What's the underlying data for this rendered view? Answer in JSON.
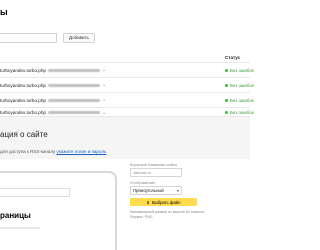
{
  "top": {
    "title_partial": "ы",
    "input_placeholder": "",
    "add_button": "Добавить",
    "status_header": "Статус",
    "rows": [
      {
        "url": "turboyandex.turbo.php",
        "status": "Без ошибок"
      },
      {
        "url": "turboyandex.turbo.php",
        "status": "Без ошибок"
      },
      {
        "url": "turboyandex.turbo.php",
        "status": "Без ошибок"
      },
      {
        "url": "turboyandex.turbo.php",
        "status": "Без ошибок"
      }
    ]
  },
  "bottom": {
    "title_partial": "ация о сайте",
    "hint_prefix": "для доступа к RSS-каналу ",
    "hint_link": "укажите логин и пароль",
    "preview_heading": "раницы",
    "fields": {
      "name_label": "Короткое название сайта",
      "name_value": "Jabroot.ru",
      "display_label": "Отображение",
      "display_value": "Прямоугольный",
      "file_button": "Выбрать файл",
      "note_line1": "Минимальный размер по высоте 64 пикселя.",
      "note_line2": "Формат: PNG"
    }
  },
  "colors": {
    "accent_yellow": "#ffdb4d",
    "ok_green": "#3dbb3d",
    "link_blue": "#1a5fc4"
  }
}
